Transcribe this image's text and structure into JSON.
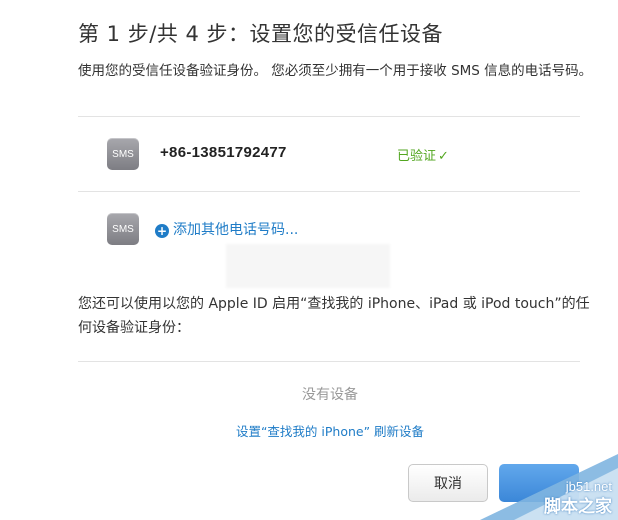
{
  "header": {
    "title": "第 1 步/共 4 步：设置您的受信任设备",
    "description": "使用您的受信任设备验证身份。 您必须至少拥有一个用于接收 SMS 信息的电话号码。"
  },
  "phones": {
    "icon_label": "SMS",
    "number": "+86-13851792477",
    "status": "已验证",
    "status_check": "✓"
  },
  "add_phone": {
    "icon_label": "SMS",
    "label": "添加其他电话号码..."
  },
  "find_my": {
    "description": "您还可以使用以您的 Apple ID 启用“查找我的 iPhone、iPad 或 iPod touch”的任何设备验证身份：",
    "no_devices": "没有设备",
    "setup_link": "设置“查找我的 iPhone” 刷新设备"
  },
  "buttons": {
    "cancel": "取消"
  },
  "watermark": {
    "url": "jb51.net",
    "name": "脚本之家"
  },
  "colors": {
    "link": "#1f7cc7",
    "verified": "#52a620",
    "primary_button": "#3b87d8"
  }
}
